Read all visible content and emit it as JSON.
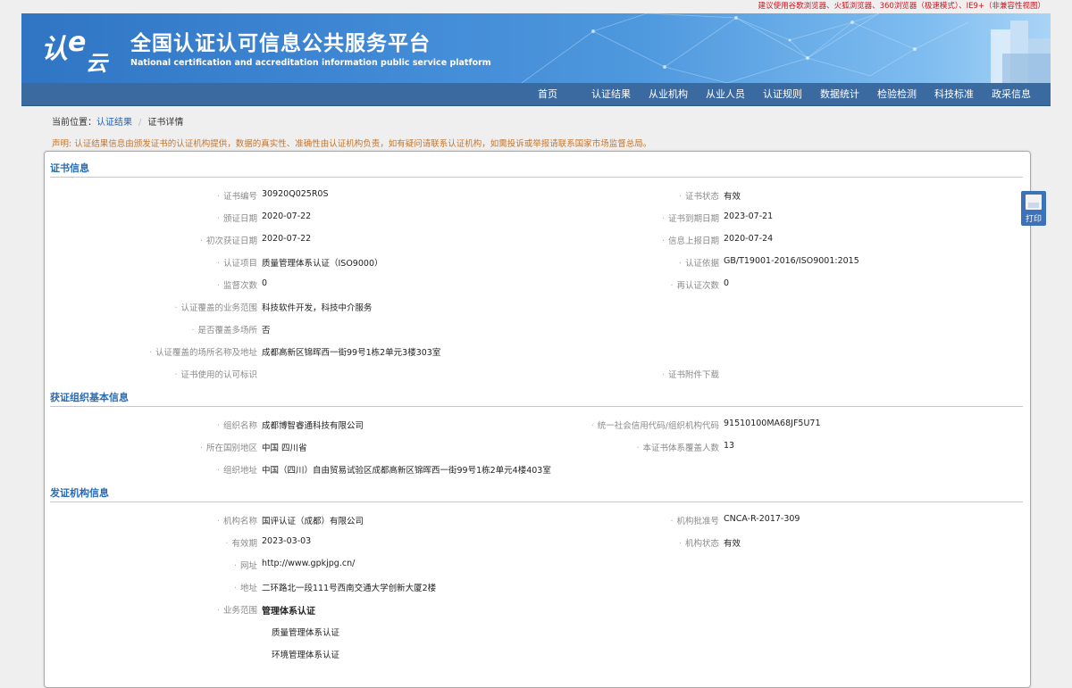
{
  "top_note": "建议使用谷歌浏览器、火狐浏览器、360浏览器（极速模式）、IE9+（非兼容性视图）",
  "site": {
    "title": "全国认证认可信息公共服务平台",
    "subtitle": "National certification and accreditation information public service platform",
    "logo_text": "认e云"
  },
  "nav": [
    "首页",
    "认证结果",
    "从业机构",
    "从业人员",
    "认证规则",
    "数据统计",
    "检验检测",
    "科技标准",
    "政采信息"
  ],
  "breadcrumb": {
    "prefix": "当前位置：",
    "link": "认证结果",
    "current": "证书详情"
  },
  "notice": "声明: 认证结果信息由颁发证书的认证机构提供，数据的真实性、准确性由认证机构负责，如有疑问请联系认证机构，如需投诉或举报请联系国家市场监督总局。",
  "print_label": "打印",
  "colors": {
    "accent": "#2a6bb5",
    "nav_bg": "#3b6aa0",
    "notice": "#c5752b",
    "top_note": "#d0121b"
  },
  "sections": {
    "cert": {
      "title": "证书信息",
      "rows": [
        [
          "证书编号",
          "30920Q025R0S",
          "证书状态",
          "有效"
        ],
        [
          "颁证日期",
          "2020-07-22",
          "证书到期日期",
          "2023-07-21"
        ],
        [
          "初次获证日期",
          "2020-07-22",
          "信息上报日期",
          "2020-07-24"
        ],
        [
          "认证项目",
          "质量管理体系认证（ISO9000）",
          "认证依据",
          "GB/T19001-2016/ISO9001:2015"
        ],
        [
          "监督次数",
          "0",
          "再认证次数",
          "0"
        ],
        [
          "认证覆盖的业务范围",
          "科技软件开发，科技中介服务",
          "",
          ""
        ],
        [
          "是否覆盖多场所",
          "否",
          "",
          ""
        ],
        [
          "认证覆盖的场所名称及地址",
          "成都高新区锦晖西一街99号1栋2单元3楼303室",
          "",
          ""
        ],
        [
          "证书使用的认可标识",
          "",
          "证书附件下载",
          ""
        ]
      ]
    },
    "org": {
      "title": "获证组织基本信息",
      "rows": [
        [
          "组织名称",
          "成都博智睿通科技有限公司",
          "统一社会信用代码/组织机构代码",
          "91510100MA68JF5U71"
        ],
        [
          "所在国别地区",
          "中国 四川省",
          "本证书体系覆盖人数",
          "13"
        ],
        [
          "组织地址",
          "中国（四川）自由贸易试验区成都高新区锦晖西一街99号1栋2单元4楼403室",
          "",
          ""
        ]
      ]
    },
    "issuer": {
      "title": "发证机构信息",
      "rows": [
        [
          "机构名称",
          "国评认证（成都）有限公司",
          "机构批准号",
          "CNCA-R-2017-309"
        ],
        [
          "有效期",
          "2023-03-03",
          "机构状态",
          "有效"
        ],
        [
          "网址",
          "http://www.gpkjpg.cn/",
          "",
          ""
        ],
        [
          "地址",
          "二环路北一段111号西南交通大学创新大厦2楼",
          "",
          ""
        ],
        [
          "业务范围",
          "管理体系认证",
          "",
          ""
        ]
      ],
      "scope_items": [
        "质量管理体系认证",
        "环境管理体系认证"
      ]
    }
  }
}
